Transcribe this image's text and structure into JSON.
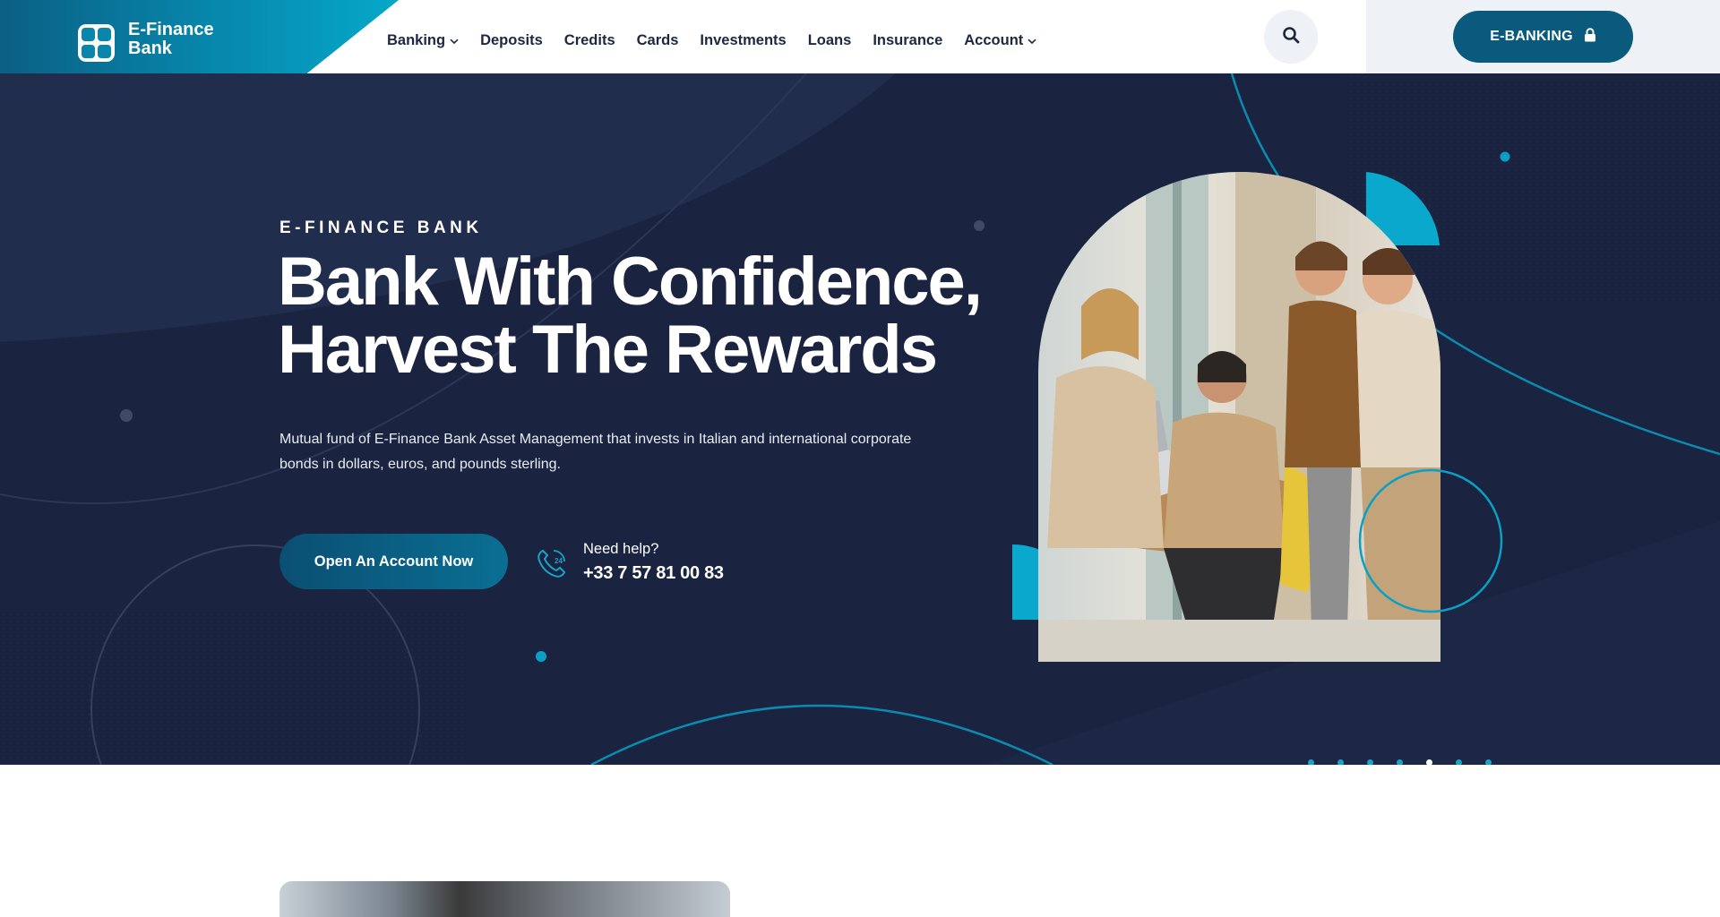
{
  "brand": {
    "name": "E-Finance Bank",
    "logo_icon": "bank-grid-icon"
  },
  "nav": {
    "items": [
      {
        "label": "Banking",
        "has_dropdown": true
      },
      {
        "label": "Deposits",
        "has_dropdown": false
      },
      {
        "label": "Credits",
        "has_dropdown": false
      },
      {
        "label": "Cards",
        "has_dropdown": false
      },
      {
        "label": "Investments",
        "has_dropdown": false
      },
      {
        "label": "Loans",
        "has_dropdown": false
      },
      {
        "label": "Insurance",
        "has_dropdown": false
      },
      {
        "label": "Account",
        "has_dropdown": true
      }
    ],
    "search_icon": "search-icon"
  },
  "ebanking": {
    "label": "E-BANKING",
    "icon": "lock-icon"
  },
  "hero": {
    "eyebrow": "E-FINANCE BANK",
    "headline_line1": "Bank With Confidence,",
    "headline_line2": "Harvest The Rewards",
    "description": "Mutual fund of E-Finance Bank Asset Management that invests in Italian and international corporate bonds in dollars, euros, and pounds sterling.",
    "cta_label": "Open An Account Now",
    "help_label": "Need help?",
    "help_phone": "+33 7 57 81 00 83",
    "help_icon": "phone-24-icon",
    "slider": {
      "total": 7,
      "active_index": 4
    }
  },
  "colors": {
    "primary": "#0a5a7e",
    "accent": "#06a8c9",
    "hero_bg": "#1a2440",
    "nav_text": "#1d2742"
  }
}
